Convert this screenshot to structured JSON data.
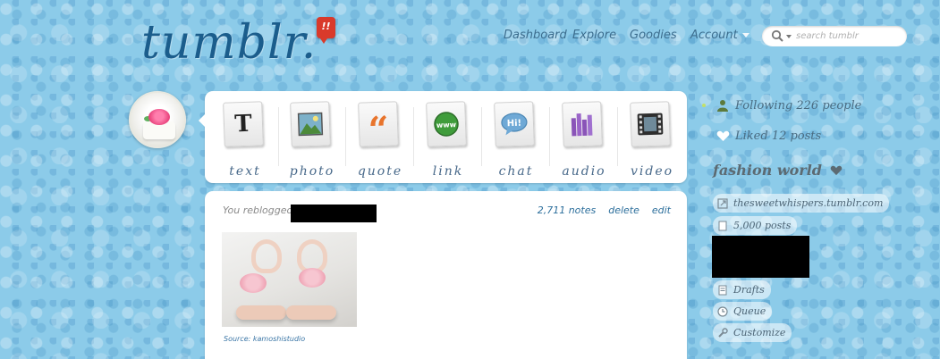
{
  "header": {
    "logo": "tumblr.",
    "badge": "!!",
    "nav": [
      "Dashboard",
      "Explore",
      "Goodies",
      "Account"
    ],
    "search_placeholder": "search tumblr"
  },
  "post_types": [
    {
      "label": "text",
      "icon": "text-icon"
    },
    {
      "label": "photo",
      "icon": "photo-icon"
    },
    {
      "label": "quote",
      "icon": "quote-icon"
    },
    {
      "label": "link",
      "icon": "link-icon"
    },
    {
      "label": "chat",
      "icon": "chat-icon"
    },
    {
      "label": "audio",
      "icon": "audio-icon"
    },
    {
      "label": "video",
      "icon": "video-icon"
    }
  ],
  "post": {
    "reblog_text": "You reblogged",
    "controls": [
      "2,711 notes",
      "delete",
      "edit"
    ],
    "source": "Source: kamoshistudio"
  },
  "sidebar": {
    "following": "Following 226 people",
    "liked": "Liked 12 posts",
    "blog_title": "fashion world",
    "blog_url": "thesweetwhispers.tumblr.com",
    "posts": "5,000 posts",
    "links": [
      "Drafts",
      "Queue",
      "Customize"
    ]
  },
  "colors": {
    "background": "#8ccbe9",
    "accent": "#2d6f9c",
    "badge": "#d93a2b"
  }
}
